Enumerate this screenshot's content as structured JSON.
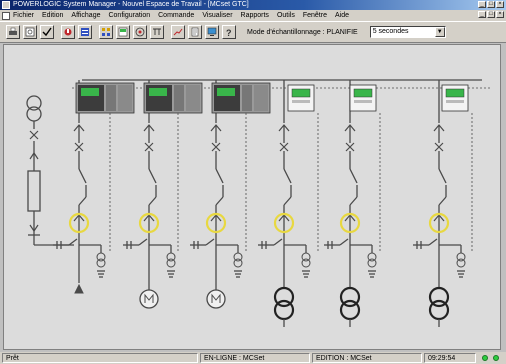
{
  "window": {
    "title": "POWERLOGIC System Manager - Nouvel Espace de Travail - [MCset GTC]",
    "title_controls": [
      "_",
      "□",
      "×"
    ]
  },
  "menu": {
    "items": [
      "Fichier",
      "Edition",
      "Affichage",
      "Configuration",
      "Commande",
      "Visualiser",
      "Rapports",
      "Outils",
      "Fenêtre",
      "Aide"
    ],
    "mdi_controls": [
      "_",
      "□",
      "×"
    ]
  },
  "toolbar": {
    "sampling_label": "Mode d'échantillonnage : PLANIFIE",
    "interval_value": "5 secondes"
  },
  "status": {
    "ready": "Prêt",
    "connection": "EN-LIGNE : MCSet",
    "edition": "EDITION : MCSet",
    "time": "09:29:54"
  },
  "colors": {
    "background": "#dcdcdc",
    "line": "#4a4a4a",
    "ct_ring": "#e8d840",
    "device_screen": "#39b54a",
    "led_on": "#2ecc40"
  }
}
